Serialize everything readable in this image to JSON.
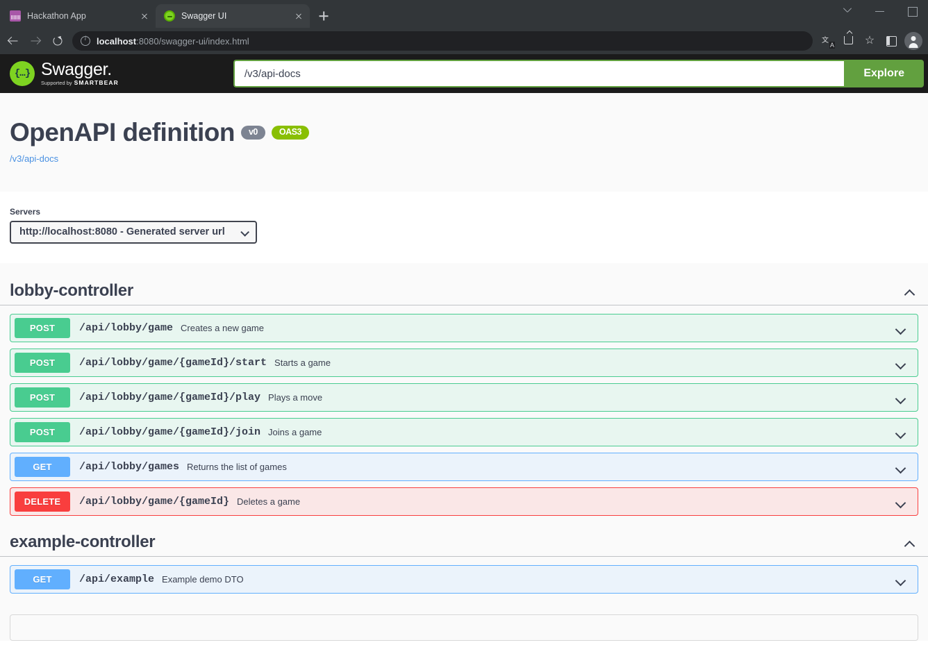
{
  "browser": {
    "tabs": [
      {
        "title": "Hackathon App",
        "favicon": "hackathon-favicon",
        "active": false
      },
      {
        "title": "Swagger UI",
        "favicon": "swagger-favicon",
        "active": true
      }
    ],
    "new_tab_label": "+",
    "url_host": "localhost",
    "url_rest": ":8080/swagger-ui/index.html",
    "toolbar_icons": [
      "translate-icon",
      "share-icon",
      "bookmark-star-icon",
      "side-panel-icon",
      "profile-avatar"
    ],
    "window_controls": [
      "chevron-down-icon",
      "minimize-icon",
      "maximize-icon"
    ]
  },
  "topbar": {
    "logo_title": "Swagger",
    "logo_dot": ".",
    "logo_supported_prefix": "Supported by",
    "logo_supported_brand": "SMARTBEAR",
    "url_value": "/v3/api-docs",
    "url_placeholder": "/v3/api-docs",
    "explore_label": "Explore"
  },
  "info": {
    "title": "OpenAPI definition",
    "version_badge": "v0",
    "oas_badge": "OAS3",
    "docs_link": "/v3/api-docs"
  },
  "servers": {
    "label": "Servers",
    "selected": "http://localhost:8080 - Generated server url",
    "options": [
      "http://localhost:8080 - Generated server url"
    ]
  },
  "sections": [
    {
      "name": "lobby-controller",
      "expanded": true,
      "operations": [
        {
          "method": "POST",
          "method_class": "post",
          "path": "/api/lobby/game",
          "summary": "Creates a new game"
        },
        {
          "method": "POST",
          "method_class": "post",
          "path": "/api/lobby/game/{gameId}/start",
          "summary": "Starts a game"
        },
        {
          "method": "POST",
          "method_class": "post",
          "path": "/api/lobby/game/{gameId}/play",
          "summary": "Plays a move"
        },
        {
          "method": "POST",
          "method_class": "post",
          "path": "/api/lobby/game/{gameId}/join",
          "summary": "Joins a game"
        },
        {
          "method": "GET",
          "method_class": "get",
          "path": "/api/lobby/games",
          "summary": "Returns the list of games"
        },
        {
          "method": "DELETE",
          "method_class": "delete",
          "path": "/api/lobby/game/{gameId}",
          "summary": "Deletes a game"
        }
      ]
    },
    {
      "name": "example-controller",
      "expanded": true,
      "operations": [
        {
          "method": "GET",
          "method_class": "get",
          "path": "/api/example",
          "summary": "Example demo DTO"
        }
      ]
    }
  ],
  "colors": {
    "post": "#49cc90",
    "get": "#61affe",
    "delete": "#f93e3e",
    "oas_badge": "#89bf04",
    "version_badge": "#7d8492",
    "explore": "#62a03f",
    "topbar_bg": "#1b1b1b",
    "text": "#3b4151"
  }
}
